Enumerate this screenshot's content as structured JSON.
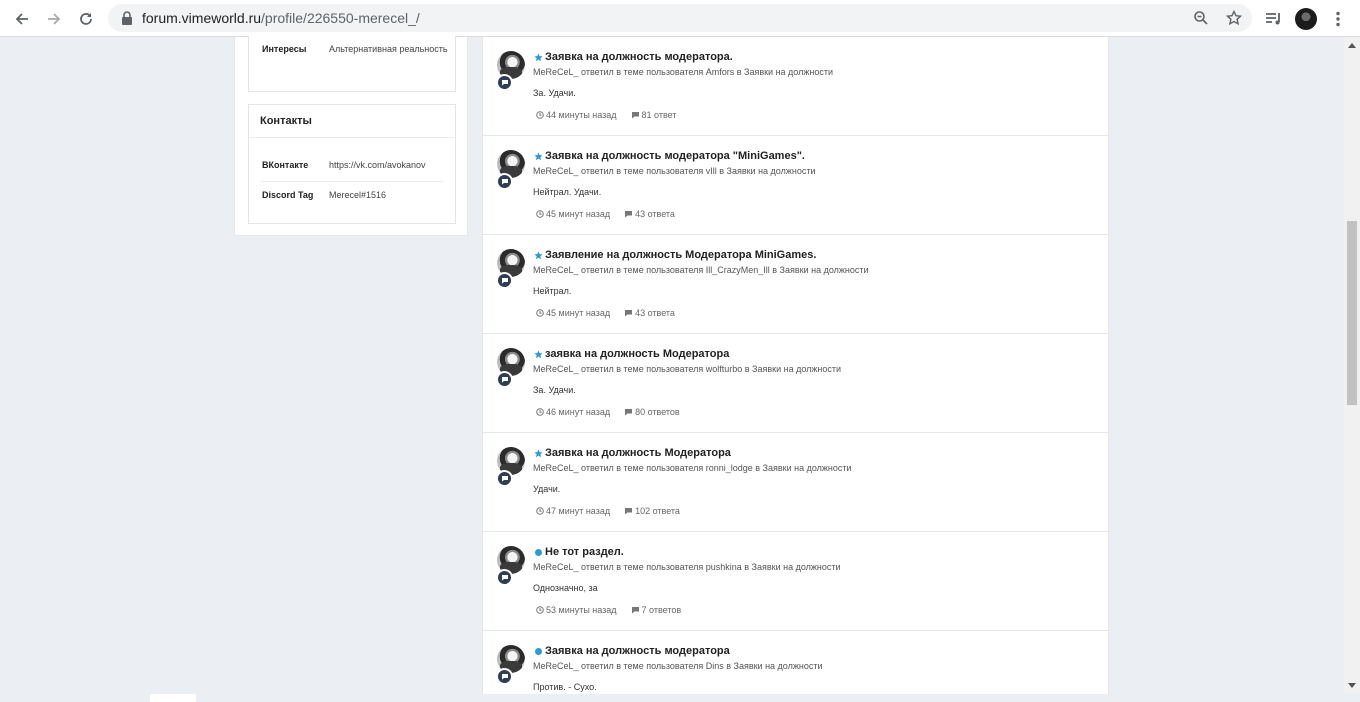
{
  "browser": {
    "url_host": "forum.vimeworld.ru",
    "url_path": "/profile/226550-merecel_/"
  },
  "sidebar": {
    "interests_label": "Интересы",
    "interests_value": "Альтернативная реальность",
    "contacts_title": "Контакты",
    "contacts": [
      {
        "label": "ВКонтакте",
        "value": "https://vk.com/avokanov"
      },
      {
        "label": "Discord Tag",
        "value": "Merecel#1516"
      }
    ]
  },
  "stream": {
    "items": [
      {
        "icon": "star",
        "title": "Заявка на должность модератора.",
        "meta": "MeReCeL_ ответил в теме пользователя Amfors в Заявки на должности",
        "snippet": "За. Удачи.",
        "time": "44 минуты назад",
        "replies": "81 ответ"
      },
      {
        "icon": "star",
        "title": "Заявка на должность модератора \"MiniGames\".",
        "meta": "MeReCeL_ ответил в теме пользователя vIll в Заявки на должности",
        "snippet": "Нейтрал. Удачи.",
        "time": "45 минут назад",
        "replies": "43 ответа"
      },
      {
        "icon": "star",
        "title": "Заявление на должность Модератора MiniGames.",
        "meta": "MeReCeL_ ответил в теме пользователя Ill_CrazyMen_Ill в Заявки на должности",
        "snippet": "Нейтрал.",
        "time": "45 минут назад",
        "replies": "43 ответа"
      },
      {
        "icon": "star",
        "title": "заявка на должность Модератора",
        "meta": "MeReCeL_ ответил в теме пользователя wolfturbo в Заявки на должности",
        "snippet": "За. Удачи.",
        "time": "46 минут назад",
        "replies": "80 ответов"
      },
      {
        "icon": "star",
        "title": "Заявка на должность Модератора",
        "meta": "MeReCeL_ ответил в теме пользователя ronni_lodge в Заявки на должности",
        "snippet": "Удачи.",
        "time": "47 минут назад",
        "replies": "102 ответа"
      },
      {
        "icon": "dot",
        "title": "Не тот раздел.",
        "meta": "MeReCeL_ ответил в теме пользователя pushkina в Заявки на должности",
        "snippet": "Однозначно, за",
        "time": "53 минуты назад",
        "replies": "7 ответов"
      },
      {
        "icon": "dot",
        "title": "Заявка на должность модератора",
        "meta": "MeReCeL_ ответил в теме пользователя Dins в Заявки на должности",
        "snippet": "Против. - Сухо.",
        "time": "",
        "replies": ""
      }
    ]
  },
  "colors": {
    "accent": "#2b9bd6",
    "bubble": "#2e3f54",
    "background": "#ebeef2"
  }
}
